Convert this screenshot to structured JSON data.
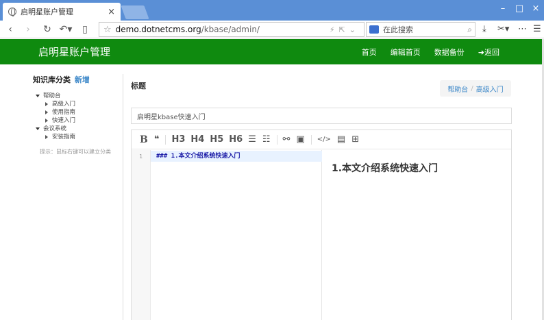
{
  "browser": {
    "tab_title": "启明星账户管理",
    "tab_close": "×",
    "url_host": "demo.dotnetcms.org",
    "url_path": "/kbase/admin/",
    "search_placeholder": "在此搜索",
    "win_min": "–",
    "win_max": "□",
    "win_close": "×"
  },
  "app": {
    "brand": "启明星账户管理",
    "nav": [
      {
        "label": "首页"
      },
      {
        "label": "编辑首页"
      },
      {
        "label": "数据备份"
      },
      {
        "label": "➜返回"
      }
    ]
  },
  "sidebar": {
    "title": "知识库分类",
    "new_label": "新增",
    "tree": [
      {
        "label": "帮助台",
        "children": [
          "高级入门",
          "使用指南",
          "快速入门"
        ]
      },
      {
        "label": "会议系统",
        "children": [
          "安装指南"
        ]
      }
    ],
    "hint": "提示：鼠标右键可以建立分类"
  },
  "main": {
    "title_label": "标题",
    "breadcrumb": [
      "帮助台",
      "高级入门"
    ],
    "breadcrumb_sep": "/",
    "title_value": "启明星kbase快速入门"
  },
  "editor": {
    "toolbar": {
      "bold": "B",
      "quote": "❝",
      "h3": "H3",
      "h4": "H4",
      "h5": "H5",
      "h6": "H6",
      "ul": "☰",
      "ol": "☷",
      "link": "⚯",
      "image": "▣",
      "code": "</>",
      "preview": "▤",
      "table": "⊞"
    },
    "line_number": "1",
    "code_line": "### 1.本文介绍系统快速入门",
    "preview_heading": "1.本文介绍系统快速入门"
  }
}
